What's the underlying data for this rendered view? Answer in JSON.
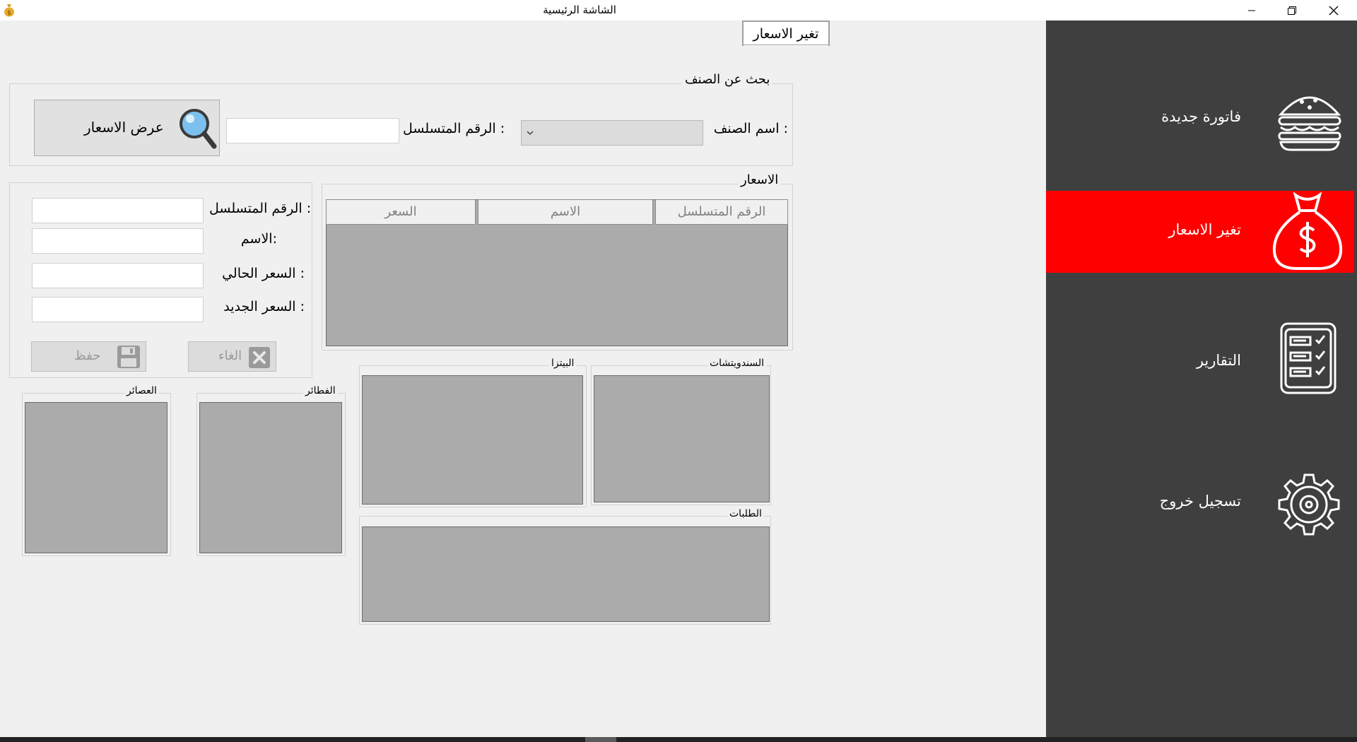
{
  "window": {
    "title": "الشاشة الرئيسية",
    "controls": [
      "minimize-icon",
      "restore-icon",
      "close-icon"
    ]
  },
  "tab": {
    "label": "تغير الاسعار"
  },
  "sidebar": {
    "background": "#3f3f3f",
    "active_color": "#ff0000",
    "items": [
      {
        "label": "فاتورة جديدة",
        "icon": "burger-icon",
        "active": false
      },
      {
        "label": "تغير الاسعار",
        "icon": "money-bag-icon",
        "active": true
      },
      {
        "label": "التقارير",
        "icon": "report-icon",
        "active": false
      },
      {
        "label": "تسجيل خروج",
        "icon": "gear-icon",
        "active": false
      }
    ]
  },
  "search": {
    "title": "بحث عن الصنف",
    "item_name_label": "اسم الصنف :",
    "item_name_value": "",
    "serial_label": "الرقم المتسلسل :",
    "serial_value": "",
    "show_prices_button": "عرض الاسعار"
  },
  "prices": {
    "title": "الاسعار",
    "columns": [
      "الرقم المتسلسل",
      "الاسم",
      "السعر"
    ],
    "rows": []
  },
  "edit": {
    "serial_label": "الرقم المتسلسل :",
    "name_label": "الاسم:",
    "current_price_label": "السعر الحالي :",
    "new_price_label": "السعر الجديد :",
    "save_button": "حفظ",
    "cancel_button": "الغاء"
  },
  "categories": {
    "sandwiches": "السندويتشات",
    "pizza": "البيتزا",
    "pies": "الفطائر",
    "juices": "العصائر",
    "orders": "الطلبات"
  }
}
